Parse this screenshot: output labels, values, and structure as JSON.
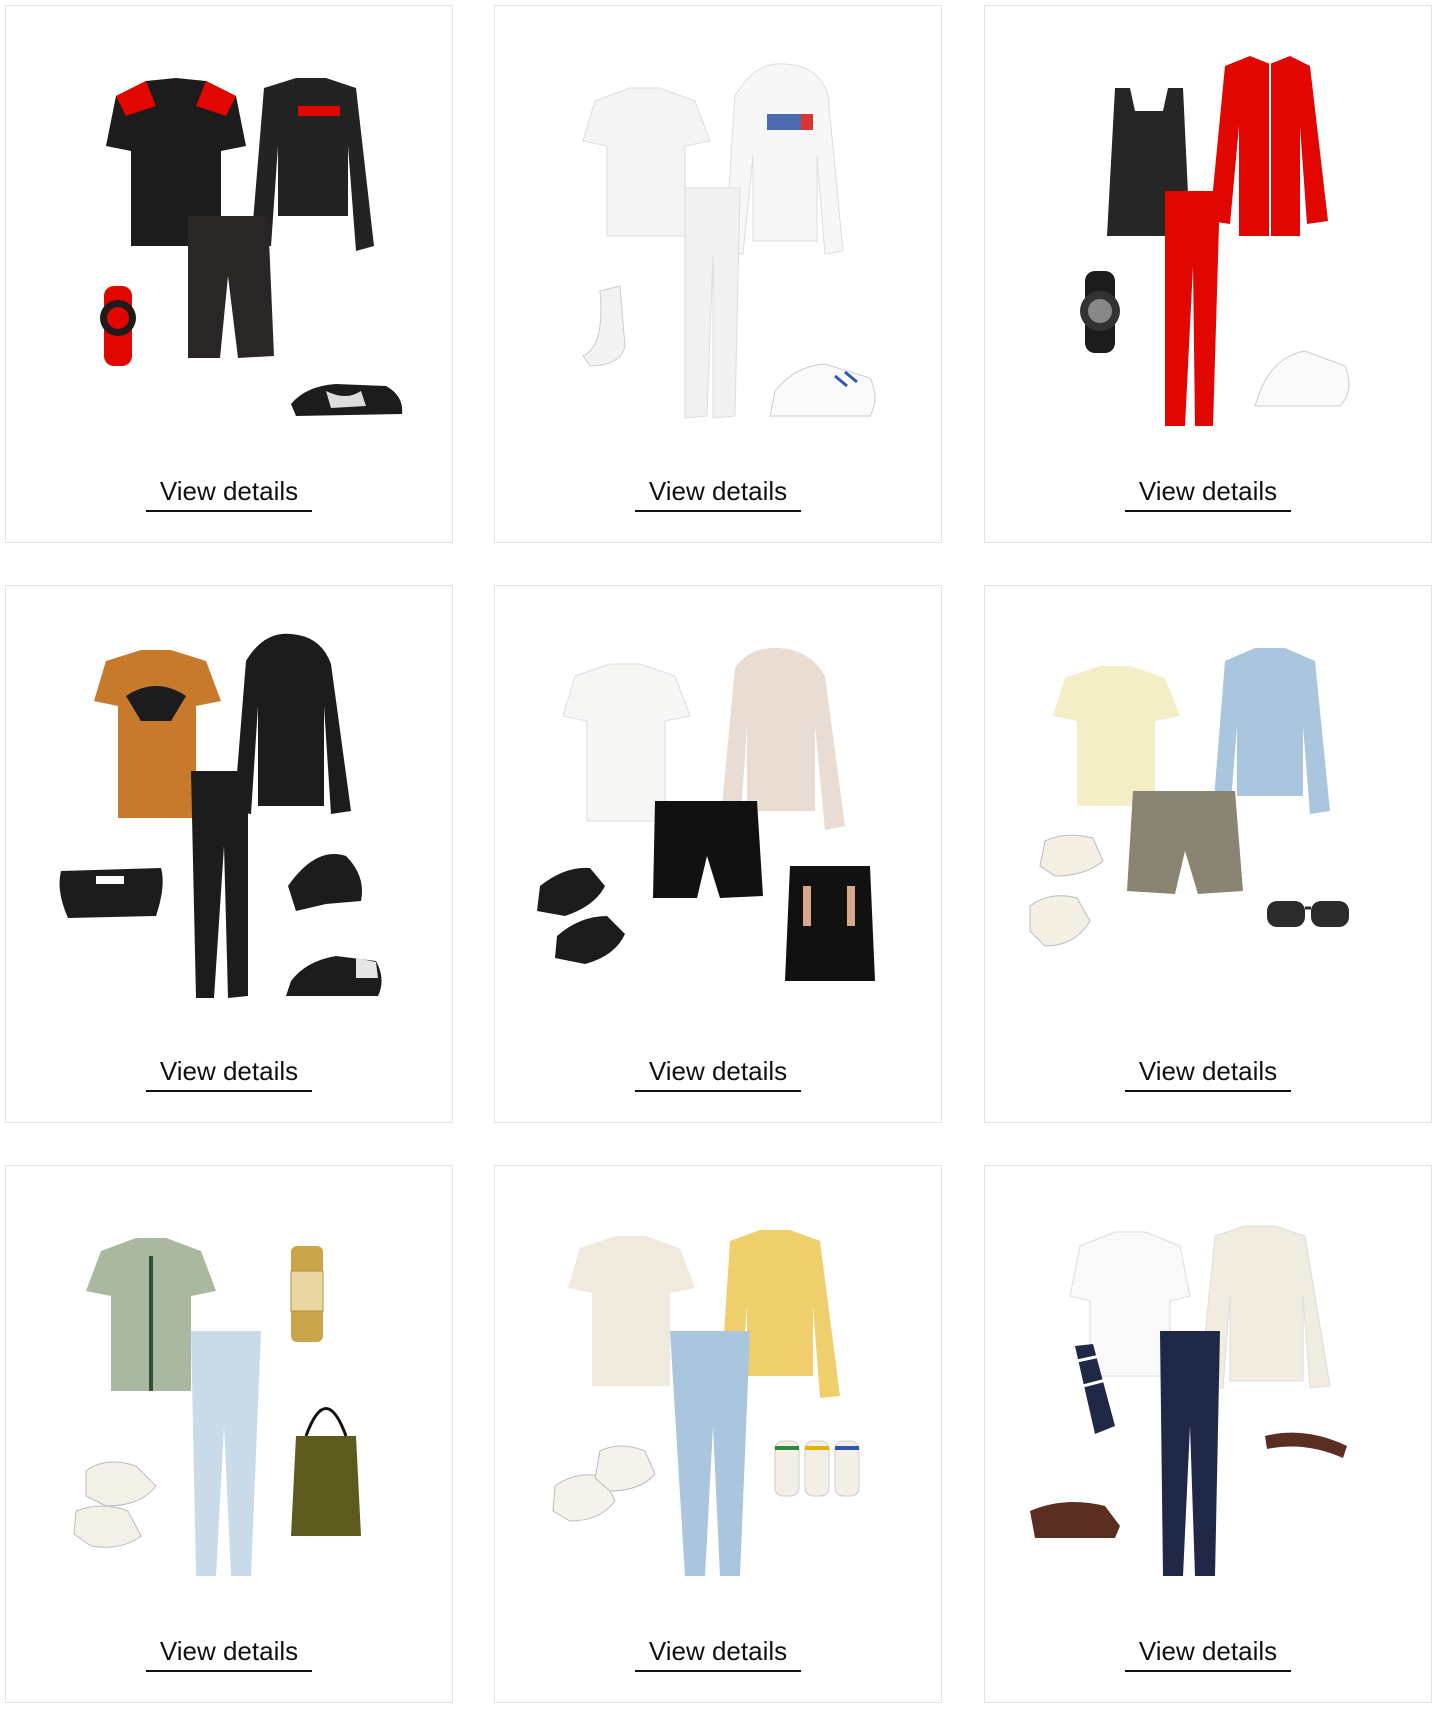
{
  "cards": [
    {
      "link_label": "View details"
    },
    {
      "link_label": "View details"
    },
    {
      "link_label": "View details"
    },
    {
      "link_label": "View details"
    },
    {
      "link_label": "View details"
    },
    {
      "link_label": "View details"
    },
    {
      "link_label": "View details"
    },
    {
      "link_label": "View details"
    },
    {
      "link_label": "View details"
    }
  ],
  "colors": {
    "border": "#e3e3e3",
    "text": "#111111",
    "ferrari_red": "#e10600",
    "black": "#1c1c1c",
    "white_item": "#f4f4f4",
    "orange_tee": "#c77a2c",
    "beige": "#e9ddd3",
    "denim": "#a9c6de",
    "olive": "#5c5a1c",
    "sage": "#a9b89e",
    "yellow": "#efcf6c",
    "navy": "#1f2947",
    "cream": "#f1ece0",
    "brown": "#5a2f22"
  }
}
